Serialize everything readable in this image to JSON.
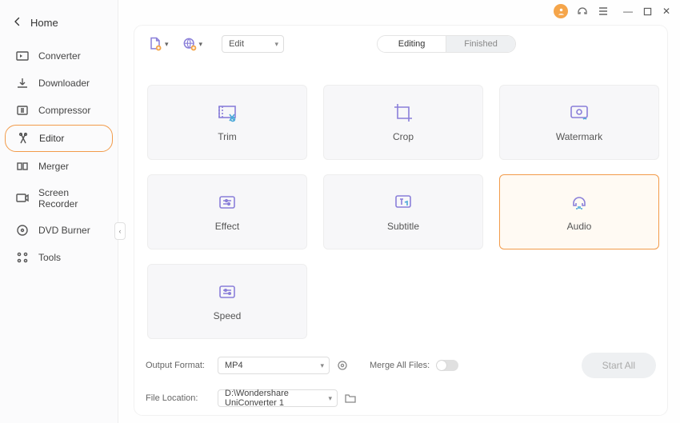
{
  "header": {
    "home": "Home"
  },
  "sidebar": {
    "items": [
      {
        "label": "Converter"
      },
      {
        "label": "Downloader"
      },
      {
        "label": "Compressor"
      },
      {
        "label": "Editor"
      },
      {
        "label": "Merger"
      },
      {
        "label": "Screen Recorder"
      },
      {
        "label": "DVD Burner"
      },
      {
        "label": "Tools"
      }
    ]
  },
  "toolbar": {
    "mode_select": "Edit",
    "seg_editing": "Editing",
    "seg_finished": "Finished"
  },
  "tiles": {
    "trim": "Trim",
    "crop": "Crop",
    "watermark": "Watermark",
    "effect": "Effect",
    "subtitle": "Subtitle",
    "audio": "Audio",
    "speed": "Speed"
  },
  "footer": {
    "output_format_label": "Output Format:",
    "output_format_value": "MP4",
    "file_location_label": "File Location:",
    "file_location_value": "D:\\Wondershare UniConverter 1",
    "merge_label": "Merge All Files:",
    "start_all": "Start All"
  }
}
